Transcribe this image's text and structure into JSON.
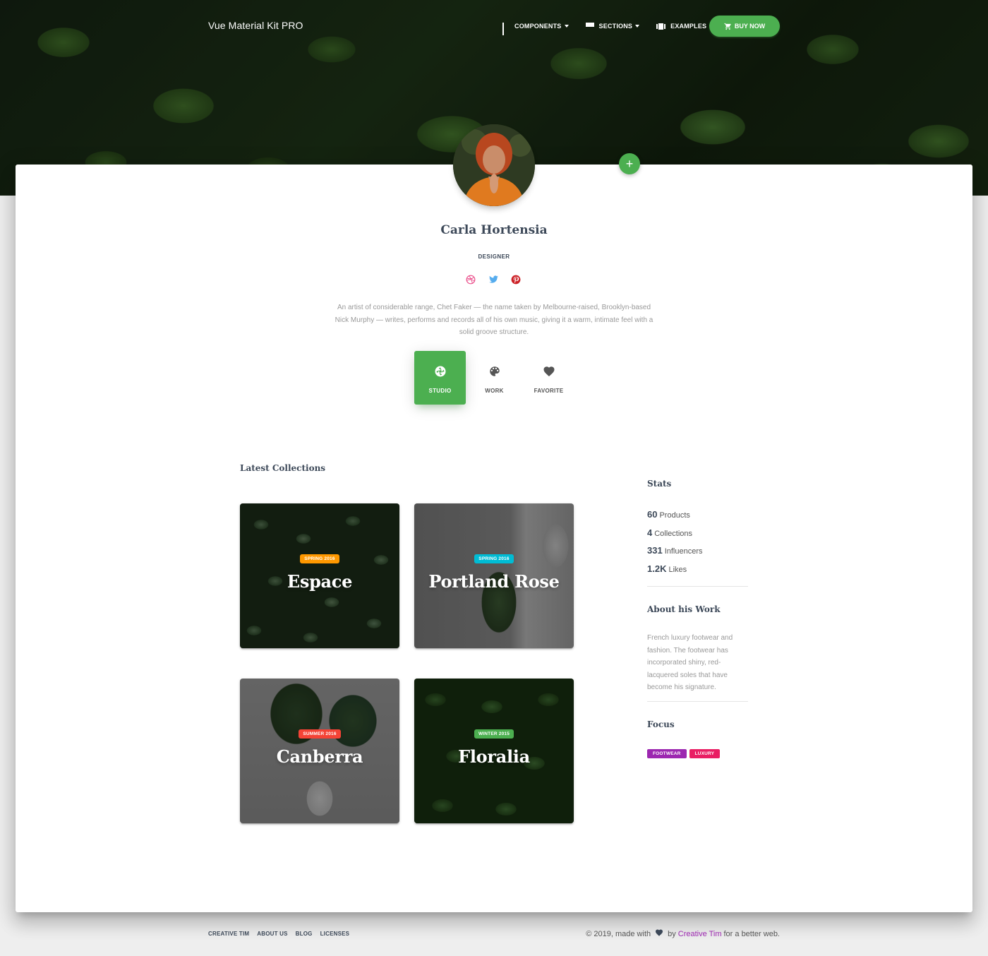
{
  "nav": {
    "brand": "Vue Material Kit PRO",
    "items": [
      {
        "label": "COMPONENTS",
        "icon": "apps-icon"
      },
      {
        "label": "SECTIONS",
        "icon": "sections-icon"
      },
      {
        "label": "EXAMPLES",
        "icon": "view-carousel-icon"
      }
    ],
    "buy_label": "BUY NOW"
  },
  "profile": {
    "name": "Carla Hortensia",
    "role": "DESIGNER",
    "socials": [
      "dribbble-icon",
      "twitter-icon",
      "pinterest-icon"
    ],
    "bio": "An artist of considerable range, Chet Faker — the name taken by Melbourne-raised, Brooklyn-based Nick Murphy — writes, performs and records all of his own music, giving it a warm, intimate feel with a solid groove structure."
  },
  "tabs": [
    {
      "label": "STUDIO",
      "icon": "camera-icon",
      "active": true
    },
    {
      "label": "WORK",
      "icon": "palette-icon",
      "active": false
    },
    {
      "label": "FAVORITE",
      "icon": "favorite-icon",
      "active": false
    }
  ],
  "collections_title": "Latest Collections",
  "collections": [
    {
      "badge": "SPRING 2016",
      "badge_color": "#ff9800",
      "title": "Espace"
    },
    {
      "badge": "SPRING 2016",
      "badge_color": "#00bcd4",
      "title": "Portland Rose"
    },
    {
      "badge": "SUMMER 2016",
      "badge_color": "#f44336",
      "title": "Canberra"
    },
    {
      "badge": "WINTER 2015",
      "badge_color": "#4caf50",
      "title": "Floralia"
    }
  ],
  "stats": {
    "title": "Stats",
    "items": [
      {
        "value": "60",
        "label": "Products"
      },
      {
        "value": "4",
        "label": "Collections"
      },
      {
        "value": "331",
        "label": "Influencers"
      },
      {
        "value": "1.2K",
        "label": "Likes"
      }
    ]
  },
  "about": {
    "title": "About his Work",
    "text": "French luxury footwear and fashion. The footwear has incorporated shiny, red-lacquered soles that have become his signature."
  },
  "focus": {
    "title": "Focus",
    "tags": [
      {
        "label": "FOOTWEAR",
        "color": "#9c27b0"
      },
      {
        "label": "LUXURY",
        "color": "#e91e63"
      }
    ]
  },
  "footer": {
    "links": [
      "CREATIVE TIM",
      "ABOUT US",
      "BLOG",
      "LICENSES"
    ],
    "copyright_prefix": "© 2019, made with",
    "by": "by",
    "brand_link": "Creative Tim",
    "suffix": "for a better web."
  },
  "colors": {
    "primary": "#4caf50",
    "text": "#3c4858",
    "muted": "#999999"
  }
}
